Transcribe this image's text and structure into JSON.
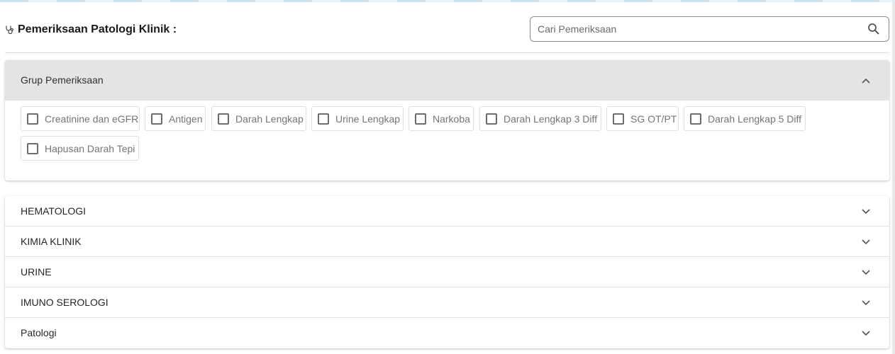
{
  "header": {
    "title": "Pemeriksaan Patologi Klinik :",
    "title_icon": "stethoscope-icon"
  },
  "search": {
    "placeholder": "Cari Pemeriksaan",
    "value": "",
    "icon": "search-icon"
  },
  "group": {
    "label": "Grup Pemeriksaan",
    "expanded": true,
    "chips": [
      {
        "label": "Creatinine dan eGFR",
        "checked": false
      },
      {
        "label": "Antigen",
        "checked": false
      },
      {
        "label": "Darah Lengkap",
        "checked": false
      },
      {
        "label": "Urine Lengkap",
        "checked": false
      },
      {
        "label": "Narkoba",
        "checked": false
      },
      {
        "label": "Darah Lengkap 3 Diff",
        "checked": false
      },
      {
        "label": "SG OT/PT",
        "checked": false
      },
      {
        "label": "Darah Lengkap 5 Diff",
        "checked": false
      },
      {
        "label": "Hapusan Darah Tepi",
        "checked": false
      }
    ]
  },
  "sections": [
    {
      "label": "HEMATOLOGI",
      "expanded": false
    },
    {
      "label": "KIMIA KLINIK",
      "expanded": false
    },
    {
      "label": "URINE",
      "expanded": false
    },
    {
      "label": "IMUNO SEROLOGI",
      "expanded": false
    },
    {
      "label": "Patologi",
      "expanded": false
    }
  ],
  "colors": {
    "group_header_bg": "#e4e4e4",
    "chip_border": "#e0e0e0",
    "chip_text": "#757575"
  }
}
